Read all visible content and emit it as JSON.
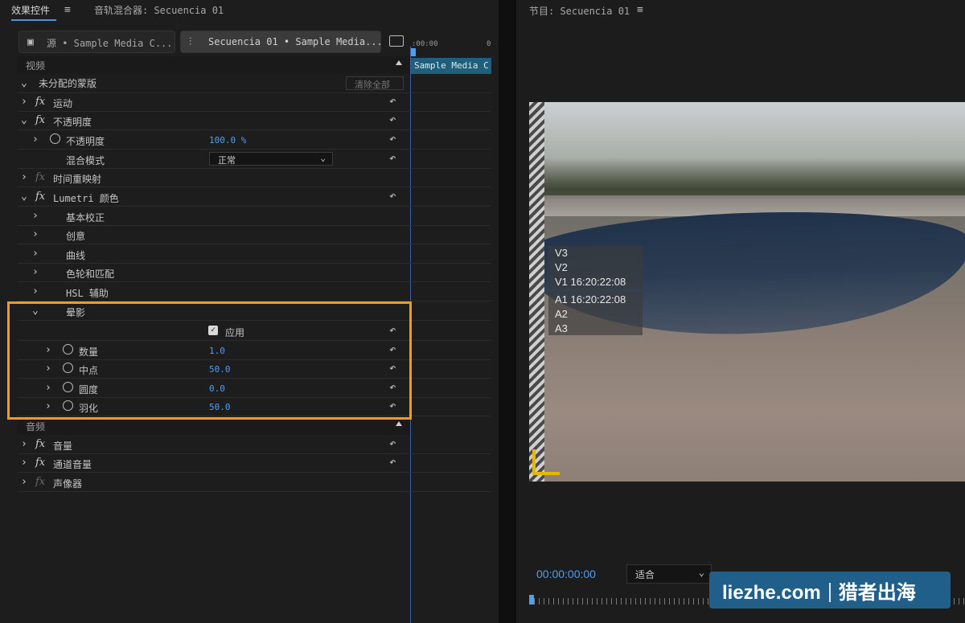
{
  "left_panel": {
    "tabs": [
      "效果控件",
      "音轨混合器: Secuencia 01"
    ],
    "menu_icon": "hamburger-icon",
    "source_tabs": [
      {
        "label": "源 • Sample Media C...",
        "icon": "source-monitor-icon"
      },
      {
        "label": "Secuencia 01 • Sample Media...",
        "icon": "sequence-icon"
      }
    ],
    "timeline": {
      "start": ":00:00",
      "end": "0",
      "clip_label": "Sample Media C"
    },
    "sections": {
      "video": "视频",
      "audio": "音频"
    },
    "clear_all": "清除全部",
    "rows": {
      "mask": "未分配的蒙版",
      "motion": "运动",
      "opacity": "不透明度",
      "opacity_value_label": "不透明度",
      "opacity_value": "100.0 %",
      "blend_label": "混合模式",
      "blend_value": "正常",
      "time_remap": "时间重映射",
      "lumetri": "Lumetri 颜色",
      "basic": "基本校正",
      "creative": "创意",
      "curves": "曲线",
      "color_wheels": "色轮和匹配",
      "hsl": "HSL 辅助",
      "vignette": "晕影",
      "apply_label": "应用",
      "amount_label": "数量",
      "amount_value": "1.0",
      "midpoint_label": "中点",
      "midpoint_value": "50.0",
      "roundness_label": "圆度",
      "roundness_value": "0.0",
      "feather_label": "羽化",
      "feather_value": "50.0",
      "volume": "音量",
      "channel_volume": "通道音量",
      "panner": "声像器"
    }
  },
  "program_monitor": {
    "title": "节目: Secuencia 01",
    "overlay_video_tracks": [
      "V3",
      "V2",
      "V1 16:20:22:08"
    ],
    "overlay_audio_tracks": [
      "A1 16:20:22:08",
      "A2",
      "A3"
    ],
    "timecode": "00:00:00:00",
    "fit": "适合"
  },
  "watermark": {
    "left": "liezhe.com",
    "right": "猎者出海"
  },
  "colors": {
    "accent_blue": "#4d9ff2",
    "highlight_orange": "#f19b22",
    "clip_teal": "#1e5f7e"
  }
}
